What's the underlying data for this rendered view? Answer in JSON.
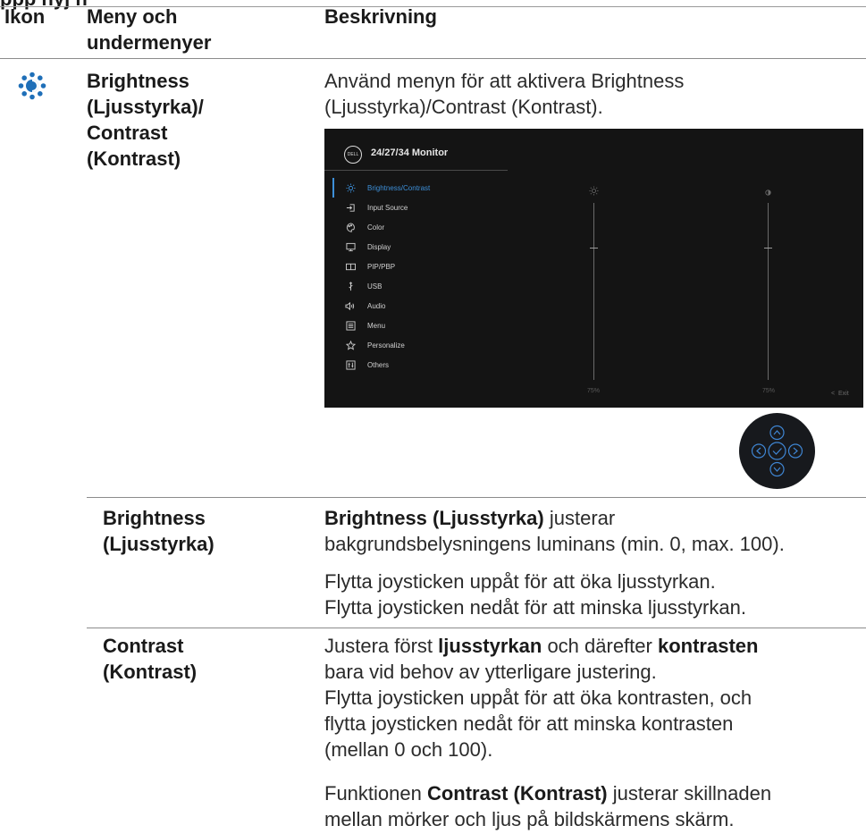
{
  "page_heading_cut": "ppp    nyj   n",
  "header": {
    "col_icon": "Ikon",
    "col_menu_line1": "Meny och",
    "col_menu_line2": "undermenyer",
    "col_desc": "Beskrivning"
  },
  "row_main": {
    "menu_line1": "Brightness",
    "menu_line2": "(Ljusstyrka)/",
    "menu_line3": "Contrast",
    "menu_line4": "(Kontrast)",
    "desc_line1": "Använd menyn för att aktivera Brightness",
    "desc_line2": "(Ljusstyrka)/Contrast (Kontrast).",
    "icon": "brightness-contrast-icon"
  },
  "osd": {
    "brand": "DELL",
    "title": "24/27/34 Monitor",
    "menu": [
      {
        "label": "Brightness/Contrast",
        "icon": "sun-icon",
        "active": true
      },
      {
        "label": "Input Source",
        "icon": "input-source-icon"
      },
      {
        "label": "Color",
        "icon": "palette-icon"
      },
      {
        "label": "Display",
        "icon": "monitor-icon"
      },
      {
        "label": "PIP/PBP",
        "icon": "pip-icon"
      },
      {
        "label": "USB",
        "icon": "usb-icon"
      },
      {
        "label": "Audio",
        "icon": "speaker-icon"
      },
      {
        "label": "Menu",
        "icon": "menu-icon"
      },
      {
        "label": "Personalize",
        "icon": "star-icon"
      },
      {
        "label": "Others",
        "icon": "others-icon"
      }
    ],
    "brightness_value": "75%",
    "contrast_value": "75%",
    "brightness_level": 0.75,
    "contrast_level": 0.75,
    "exit_label": "Exit",
    "accent_color": "#3d8fd8"
  },
  "row_brightness": {
    "menu_line1": "Brightness",
    "menu_line2": "(Ljusstyrka)",
    "desc_bold": "Brightness (Ljusstyrka)",
    "desc_rest": " justerar",
    "desc_line2": "bakgrundsbelysningens luminans (min. 0, max. 100).",
    "desc_line3": "Flytta joysticken uppåt för att öka ljusstyrkan.",
    "desc_line4": "Flytta joysticken nedåt för att minska ljusstyrkan."
  },
  "row_contrast": {
    "menu_line1": "Contrast",
    "menu_line2": "(Kontrast)",
    "p1_a": "Justera först ",
    "p1_b": "ljusstyrkan",
    "p1_c": " och därefter ",
    "p1_d": "kontrasten",
    "p1_line2": "bara vid behov av ytterligare justering.",
    "p1_line3": "Flytta joysticken uppåt för att öka kontrasten, och",
    "p1_line4": "flytta joysticken nedåt för att minska kontrasten",
    "p1_line5": "(mellan 0 och 100).",
    "p2_a": "Funktionen ",
    "p2_b": "Contrast (Kontrast)",
    "p2_c": " justerar skillnaden",
    "p2_line2": "mellan mörker och ljus på bildskärmens skärm."
  }
}
